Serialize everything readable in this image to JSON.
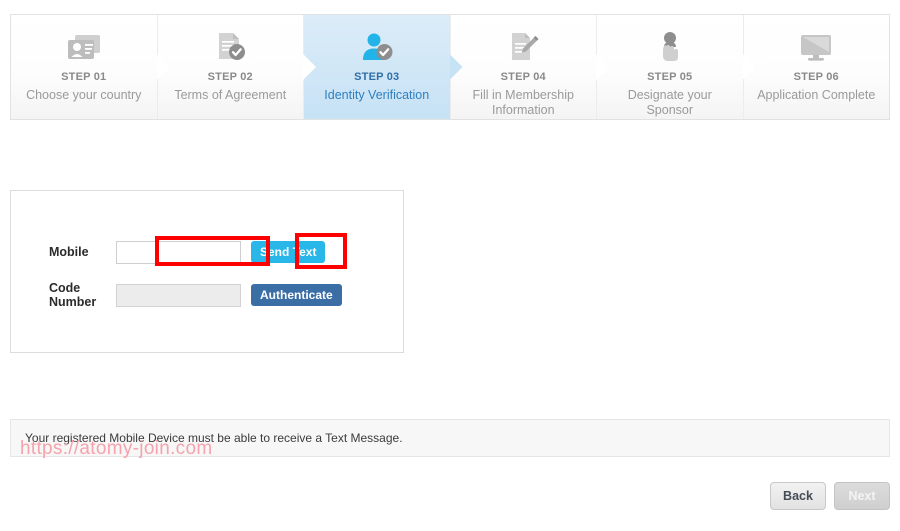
{
  "steps": [
    {
      "number": "STEP 01",
      "label": "Choose your country",
      "icon": "id-card-icon",
      "active": false
    },
    {
      "number": "STEP 02",
      "label": "Terms of Agreement",
      "icon": "document-check-icon",
      "active": false
    },
    {
      "number": "STEP 03",
      "label": "Identity Verification",
      "icon": "person-check-icon",
      "active": true
    },
    {
      "number": "STEP 04",
      "label": "Fill in Membership Information",
      "icon": "document-pencil-icon",
      "active": false
    },
    {
      "number": "STEP 05",
      "label": "Designate your Sponsor",
      "icon": "hand-person-icon",
      "active": false
    },
    {
      "number": "STEP 06",
      "label": "Application Complete",
      "icon": "monitor-icon",
      "active": false
    }
  ],
  "form": {
    "mobile": {
      "label": "Mobile",
      "value": "",
      "placeholder": "",
      "button_label": "Send Text"
    },
    "code_number": {
      "label": "Code Number",
      "value": "",
      "placeholder": "",
      "button_label": "Authenticate"
    }
  },
  "notice": {
    "text": "Your registered Mobile Device must be able to receive a Text Message."
  },
  "watermark": {
    "text": "https://atomy-join.com"
  },
  "footer": {
    "back_label": "Back",
    "next_label": "Next"
  },
  "colors": {
    "active_step_bg": "#c6e2f5",
    "active_step_text": "#2f7fc1",
    "send_text_button": "#29b6e8",
    "authenticate_button": "#3a6ea5",
    "annotation": "#ff0000",
    "watermark": "#f5a3ac"
  }
}
